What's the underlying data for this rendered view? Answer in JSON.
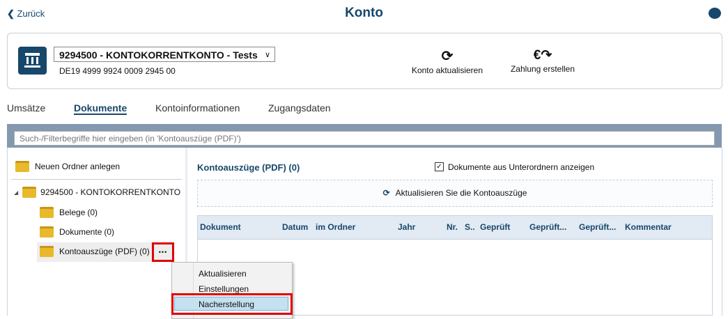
{
  "header": {
    "back": "Zurück",
    "title": "Konto"
  },
  "account": {
    "name": "9294500 - KONTOKORRENTKONTO - Tests",
    "iban": "DE19 4999 9924 0009 2945 00",
    "actions": [
      {
        "label": "Konto aktualisieren",
        "icon": "refresh-icon"
      },
      {
        "label": "Zahlung erstellen",
        "icon": "euro-send-icon"
      }
    ]
  },
  "tabs": [
    "Umsätze",
    "Dokumente",
    "Kontoinformationen",
    "Zugangsdaten"
  ],
  "active_tab": "Dokumente",
  "search": {
    "placeholder": "Such-/Filterbegriffe hier eingeben (in 'Kontoauszüge (PDF)')"
  },
  "tree": {
    "new_folder": "Neuen Ordner anlegen",
    "root": "9294500 - KONTOKORRENTKONTO",
    "items": [
      {
        "label": "Belege",
        "count": "(0)"
      },
      {
        "label": "Dokumente",
        "count": "(0)"
      },
      {
        "label": "Kontoauszüge (PDF)",
        "count": "(0)"
      }
    ],
    "more": "•••"
  },
  "main": {
    "title": "Kontoauszüge (PDF) (0)",
    "checkbox_label": "Dokumente aus Unterordnern anzeigen",
    "checkbox_checked": true,
    "refresh": "Aktualisieren Sie die Kontoauszüge",
    "columns": [
      "Dokument",
      "Datum",
      "im Ordner",
      "Jahr",
      "Nr.",
      "S..",
      "Geprüft",
      "Geprüft...",
      "Geprüft...",
      "Kommentar"
    ]
  },
  "context_menu": {
    "items": [
      "Aktualisieren",
      "Einstellungen",
      "Nacherstellung"
    ],
    "highlighted": "Nacherstellung"
  },
  "colors": {
    "brand": "#17476b",
    "highlight_box": "#e00000"
  }
}
